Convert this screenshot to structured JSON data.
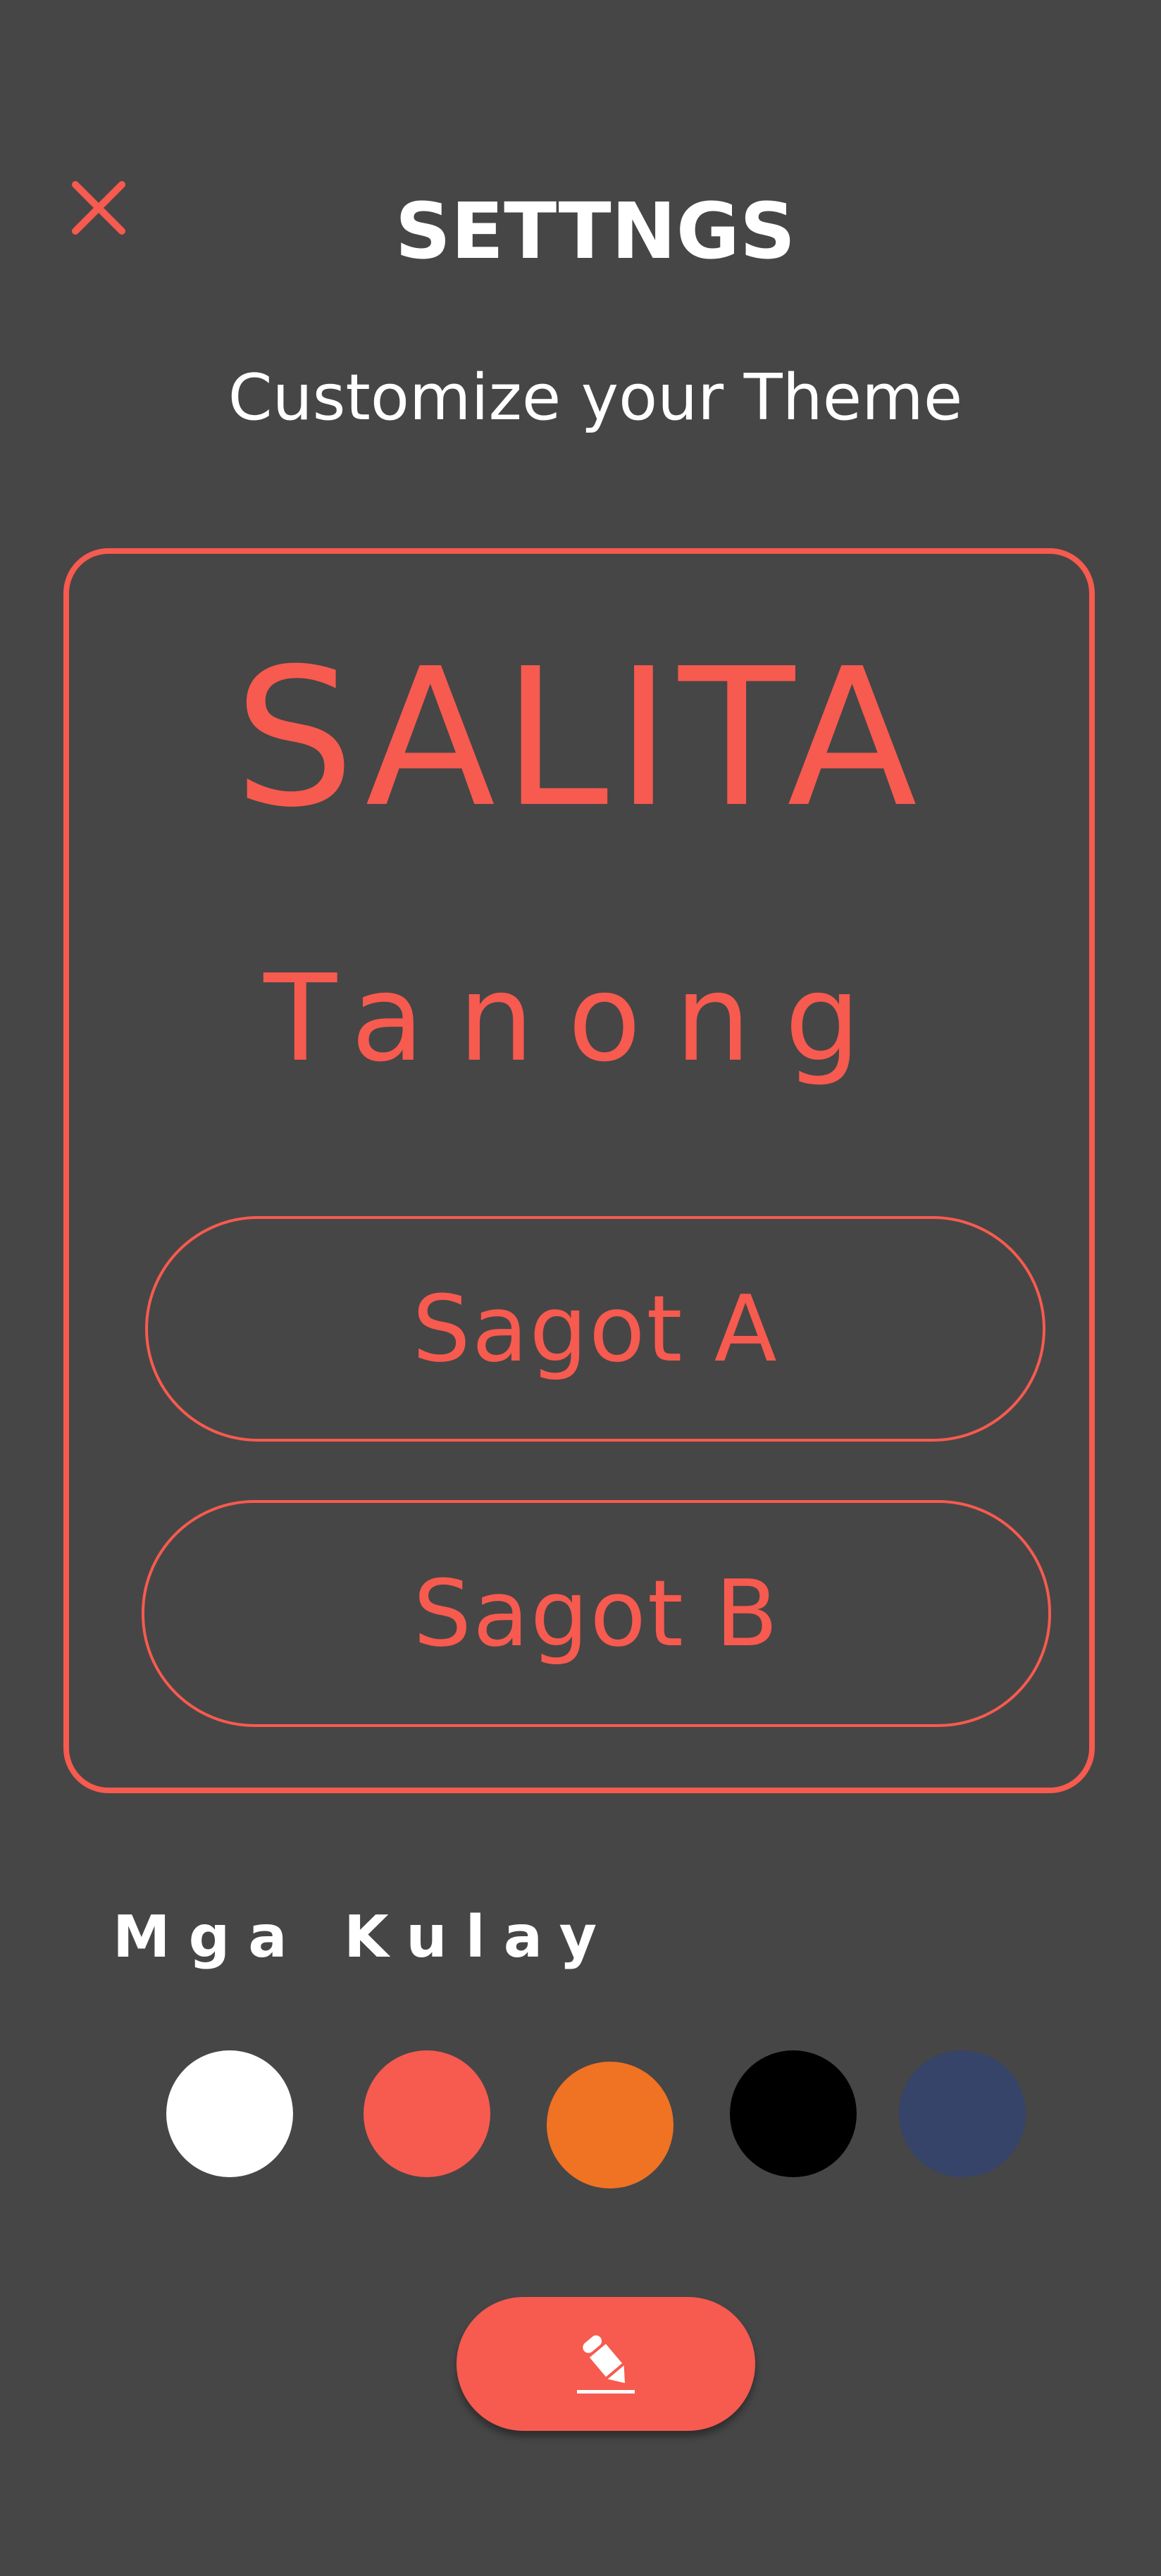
{
  "header": {
    "title": "SETTNGS",
    "subtitle": "Customize your Theme",
    "close_icon": "close-icon"
  },
  "preview": {
    "word": "SALITA",
    "question": "Tanong",
    "answers": [
      "Sagot A",
      "Sagot B"
    ],
    "accent_color": "#f75a4f"
  },
  "colors": {
    "label": "Mga Kulay",
    "options": [
      "#ffffff",
      "#f75a4f",
      "#f07223",
      "#000000",
      "#354468"
    ]
  },
  "edit_button": {
    "icon": "pencil-icon"
  },
  "background_color": "#464646"
}
